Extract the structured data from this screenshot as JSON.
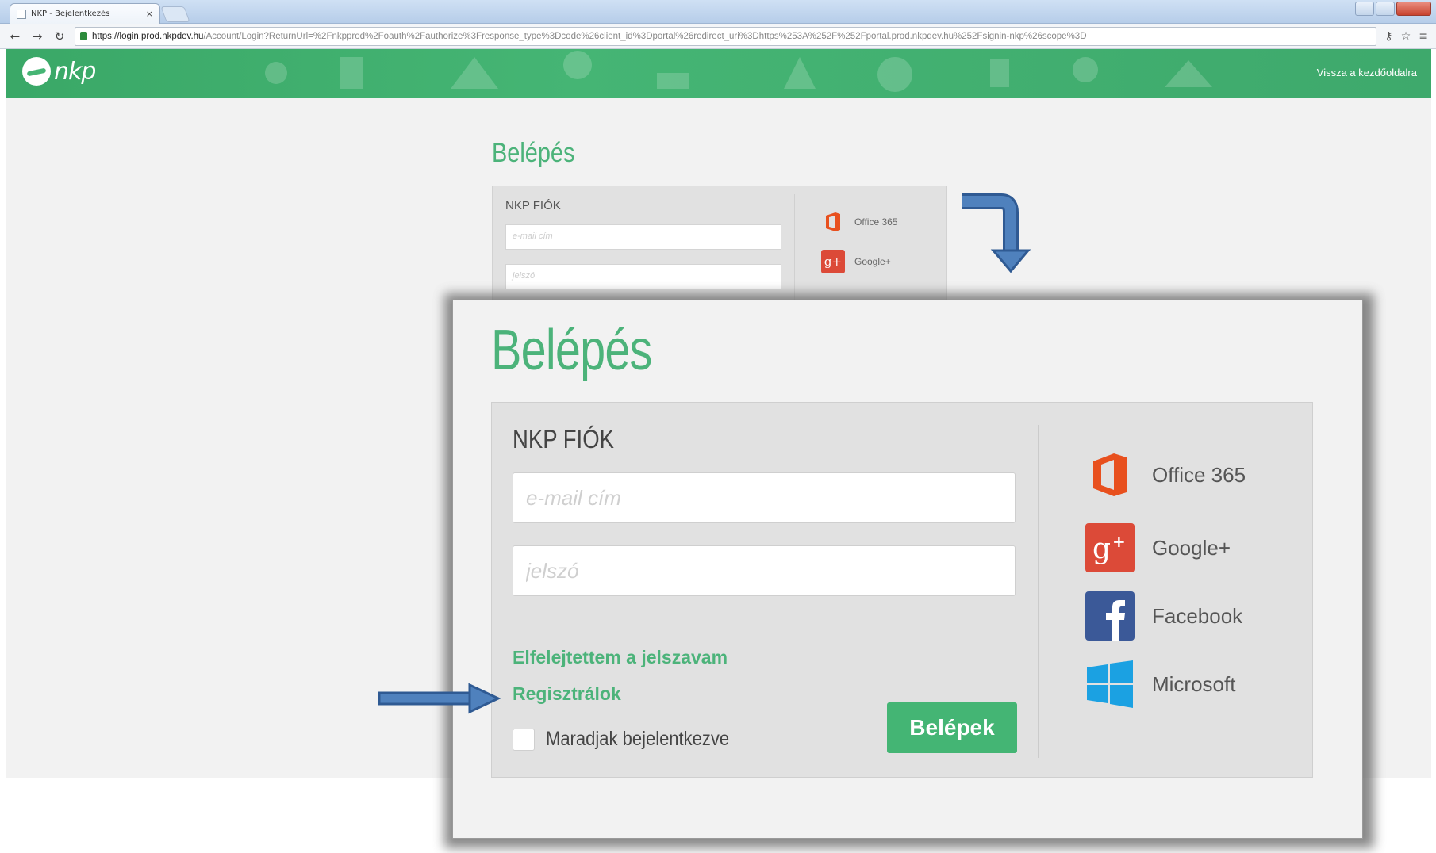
{
  "browser": {
    "tab_title": "NKP - Bejelentkezés",
    "tab_close": "×",
    "url_host": "https://login.prod.nkpdev.hu",
    "url_path": "/Account/Login?ReturnUrl=%2Fnkpprod%2Foauth%2Fauthorize%3Fresponse_type%3Dcode%26client_id%3Dportal%26redirect_uri%3Dhttps%253A%252F%252Fportal.prod.nkpdev.hu%252Fsignin-nkp%26scope%3D"
  },
  "header": {
    "logo_text": "nkp",
    "back_home": "Vissza a kezdőoldalra",
    "brand_color": "#45b574"
  },
  "background_login": {
    "title": "Belépés",
    "account_label": "NKP FIÓK",
    "email_placeholder": "e-mail cím",
    "password_placeholder": "jelszó",
    "providers": [
      "Office 365",
      "Google+"
    ]
  },
  "login": {
    "title": "Belépés",
    "account_label": "NKP FIÓK",
    "email_placeholder": "e-mail cím",
    "password_placeholder": "jelszó",
    "forgot_password": "Elfelejtettem a jelszavam",
    "register": "Regisztrálok",
    "remember_me": "Maradjak bejelentkezve",
    "submit": "Belépek",
    "providers": [
      {
        "name": "Office 365",
        "icon": "office365-icon",
        "color": "#e8501e"
      },
      {
        "name": "Google+",
        "icon": "google-plus-icon",
        "color": "#dc4a38"
      },
      {
        "name": "Facebook",
        "icon": "facebook-icon",
        "color": "#3b5998"
      },
      {
        "name": "Microsoft",
        "icon": "windows-icon",
        "color": "#1ba1e2"
      }
    ]
  }
}
